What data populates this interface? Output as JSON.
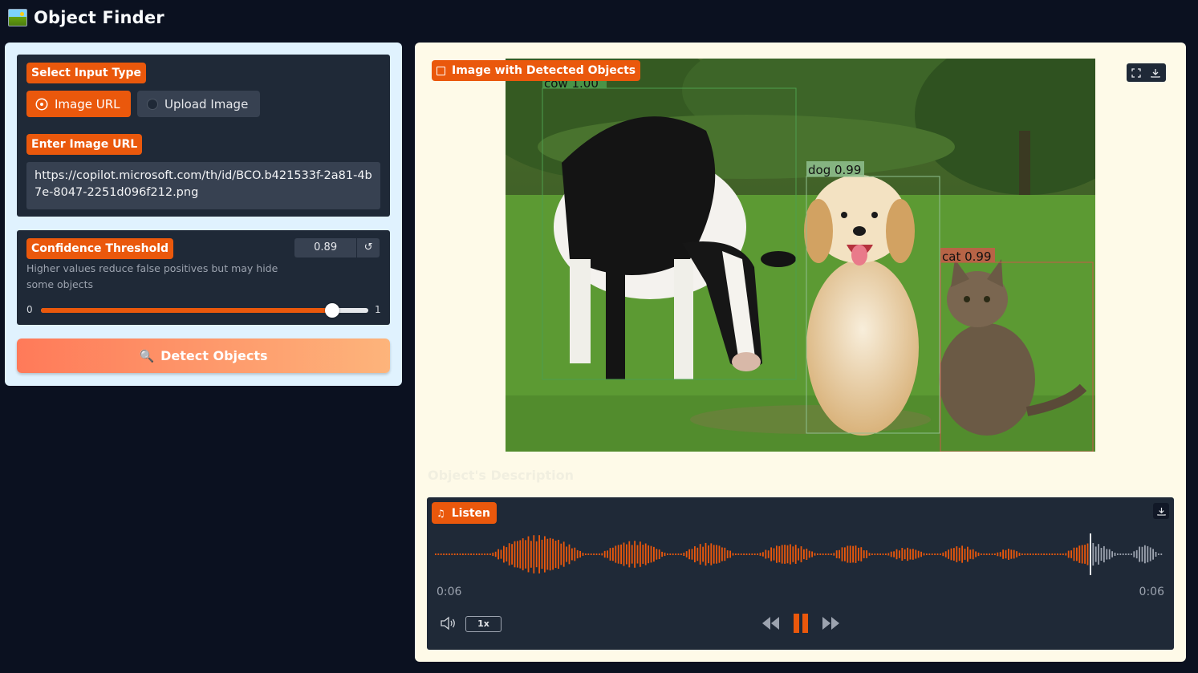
{
  "app": {
    "title": "Object Finder",
    "logo_icon": "image-icon"
  },
  "input_type": {
    "label": "Select Input Type",
    "options": [
      {
        "label": "Image URL",
        "selected": true
      },
      {
        "label": "Upload Image",
        "selected": false
      }
    ]
  },
  "image_url": {
    "label": "Enter Image URL",
    "value": "https://copilot.microsoft.com/th/id/BCO.b421533f-2a81-4b7e-8047-2251d096f212.png"
  },
  "confidence": {
    "label": "Confidence Threshold",
    "value": "0.89",
    "description": "Higher values reduce false positives but may hide some objects",
    "min": "0",
    "max": "1",
    "fraction": 0.89
  },
  "detect_button": {
    "label": "Detect Objects",
    "icon": "magnifier-icon"
  },
  "output_image": {
    "label": "Image with Detected Objects",
    "detections": [
      {
        "label": "cow 1.00",
        "color": "#4d9e4d"
      },
      {
        "label": "dog 0.99",
        "color": "#8fbf8f"
      },
      {
        "label": "cat 0.99",
        "color": "#c75a4a"
      }
    ]
  },
  "description_title": "Object's Description",
  "audio": {
    "label": "Listen",
    "current_time": "0:06",
    "duration": "0:06",
    "speed": "1x",
    "progress": 0.9
  },
  "colors": {
    "accent": "#ea580c",
    "panel_dark": "#1f2937",
    "page_bg": "#0b1120"
  }
}
